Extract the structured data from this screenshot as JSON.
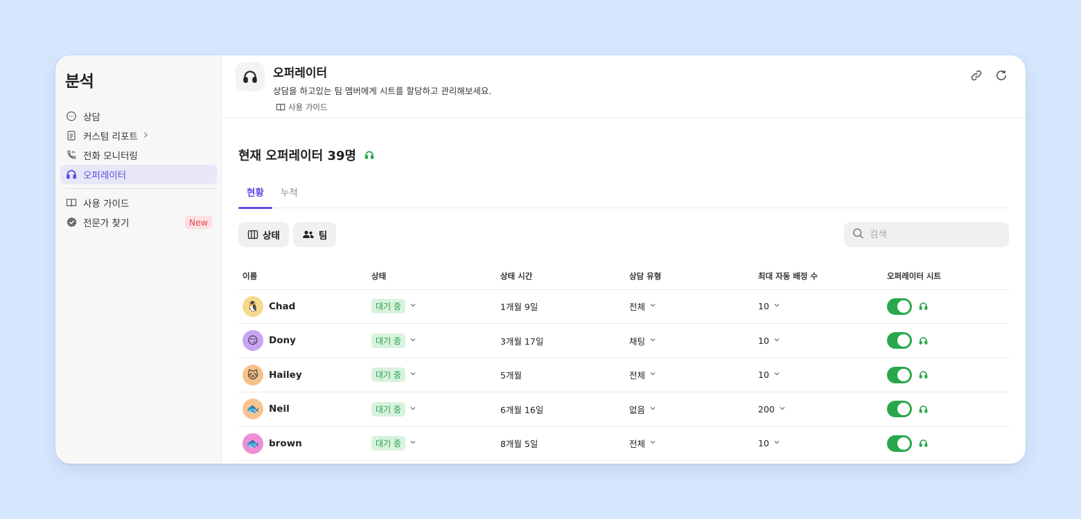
{
  "sidebar": {
    "title": "분석",
    "items": [
      {
        "label": "상담",
        "icon": "chat-bubble-icon"
      },
      {
        "label": "커스텀 리포트",
        "icon": "report-icon",
        "has_chevron": true
      },
      {
        "label": "전화 모니터링",
        "icon": "phone-icon"
      },
      {
        "label": "오퍼레이터",
        "icon": "headset-icon",
        "active": true
      }
    ],
    "secondary_items": [
      {
        "label": "사용 가이드",
        "icon": "book-icon"
      },
      {
        "label": "전문가 찾기",
        "icon": "verified-badge-icon",
        "badge": "New"
      }
    ]
  },
  "header": {
    "title": "오퍼레이터",
    "description": "상담을 하고있는 팀 멤버에게 시트를 할당하고 관리해보세요.",
    "guide_link": "사용 가이드",
    "actions": [
      "link-icon",
      "refresh-icon"
    ]
  },
  "main": {
    "count_title": "현재 오퍼레이터 39명",
    "tabs": [
      {
        "label": "현황",
        "active": true
      },
      {
        "label": "누적",
        "active": false
      }
    ],
    "toolbar": {
      "status_button": "상태",
      "team_button": "팀",
      "search_placeholder": "검색"
    },
    "table": {
      "columns": [
        "이름",
        "상태",
        "상태 시간",
        "상담 유형",
        "최대 자동 배정 수",
        "오퍼레이터 시트"
      ],
      "rows": [
        {
          "name": "Chad",
          "avatar": "🐧",
          "avatar_bg": "#f6d98f",
          "status": "대기 중",
          "status_time": "1개월 9일",
          "type": "전체",
          "max_assign": "10",
          "seat_on": true
        },
        {
          "name": "Dony",
          "avatar": "😏",
          "avatar_bg": "#c9a4f0",
          "status": "대기 중",
          "status_time": "3개월 17일",
          "type": "채팅",
          "max_assign": "10",
          "seat_on": true
        },
        {
          "name": "Hailey",
          "avatar": "🐱",
          "avatar_bg": "#f6c28a",
          "status": "대기 중",
          "status_time": "5개월",
          "type": "전체",
          "max_assign": "10",
          "seat_on": true
        },
        {
          "name": "Neil",
          "avatar": "🐟",
          "avatar_bg": "#f7c48f",
          "status": "대기 중",
          "status_time": "6개월 16일",
          "type": "없음",
          "max_assign": "200",
          "seat_on": true
        },
        {
          "name": "brown",
          "avatar": "🐟",
          "avatar_bg": "#ee8fd6",
          "status": "대기 중",
          "status_time": "8개월 5일",
          "type": "전체",
          "max_assign": "10",
          "seat_on": true
        }
      ]
    }
  },
  "colors": {
    "accent": "#5b4ee0",
    "online_green": "#28a84b",
    "badge_red": "#e44b57"
  }
}
